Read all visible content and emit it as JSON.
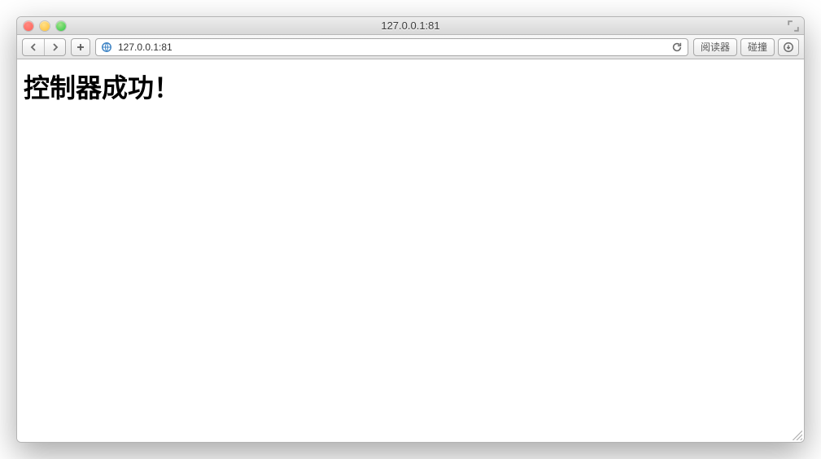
{
  "window": {
    "title": "127.0.0.1:81"
  },
  "toolbar": {
    "reader_label": "阅读器",
    "share_label": "碰撞"
  },
  "address": {
    "url": "127.0.0.1:81"
  },
  "page": {
    "heading": "控制器成功！"
  }
}
